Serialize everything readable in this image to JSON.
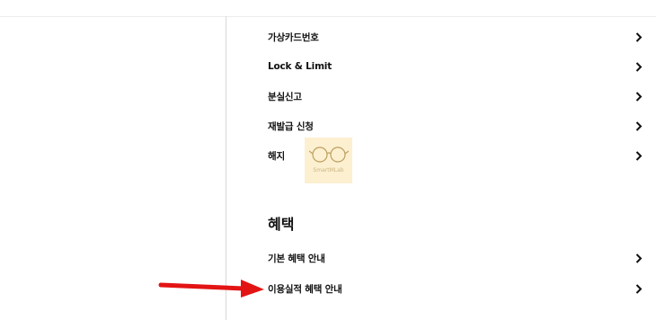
{
  "menu": {
    "items": [
      {
        "label": "가상카드번호"
      },
      {
        "label": "Lock & Limit"
      },
      {
        "label": "분실신고"
      },
      {
        "label": "재발급 신청"
      },
      {
        "label": "해지"
      }
    ]
  },
  "benefits": {
    "title": "혜택",
    "items": [
      {
        "label": "기본 혜택 안내"
      },
      {
        "label": "이용실적 혜택 안내"
      }
    ]
  },
  "watermark": {
    "text": "SmartMLab"
  },
  "colors": {
    "arrow": "#e31414",
    "text": "#111111",
    "divider": "#d8d8d8",
    "watermark_bg": "#fdf0cf"
  },
  "icons": {
    "chevron": "chevron-right-icon",
    "watermark": "glasses-icon",
    "annotation": "red-arrow"
  }
}
